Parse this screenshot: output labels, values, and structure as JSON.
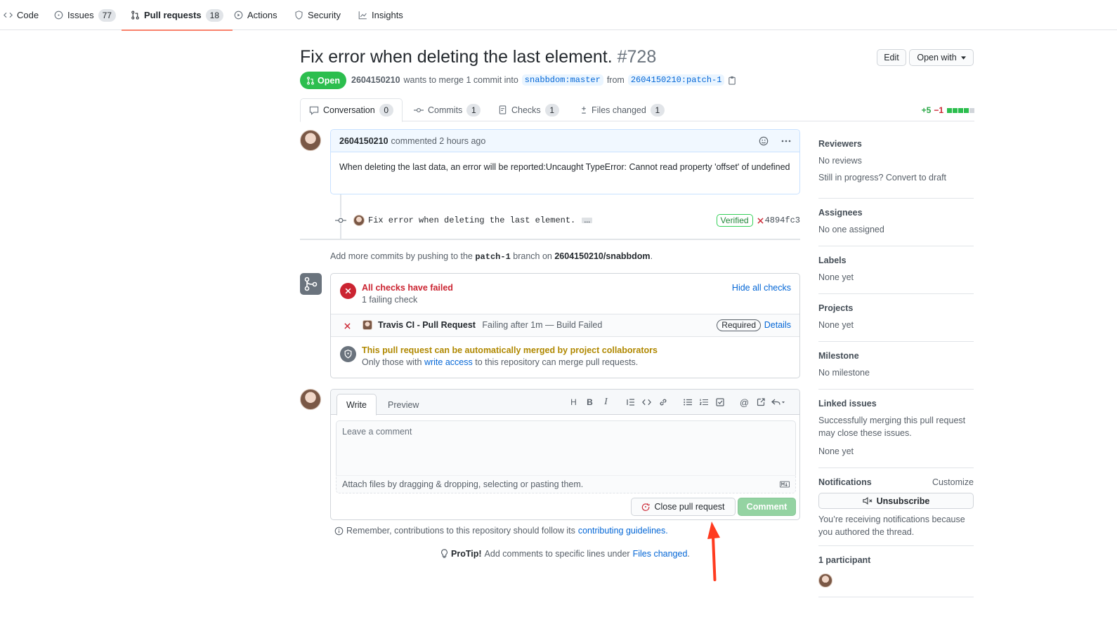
{
  "repo_nav": {
    "items": [
      {
        "label": "Code",
        "count": null
      },
      {
        "label": "Issues",
        "count": "77"
      },
      {
        "label": "Pull requests",
        "count": "18"
      },
      {
        "label": "Actions",
        "count": null
      },
      {
        "label": "Security",
        "count": null
      },
      {
        "label": "Insights",
        "count": null
      }
    ]
  },
  "header": {
    "title": "Fix error when deleting the last element.",
    "number": "#728",
    "edit_label": "Edit",
    "open_with_label": "Open with",
    "state": "Open",
    "author": "2604150210",
    "merge_text": "wants to merge 1 commit into",
    "base_branch": "snabbdom:master",
    "from_text": "from",
    "head_branch": "2604150210:patch-1"
  },
  "tabs": [
    {
      "label": "Conversation",
      "count": "0"
    },
    {
      "label": "Commits",
      "count": "1"
    },
    {
      "label": "Checks",
      "count": "1"
    },
    {
      "label": "Files changed",
      "count": "1"
    }
  ],
  "diffstat": {
    "additions": "+5",
    "deletions": "−1"
  },
  "comment": {
    "author": "2604150210",
    "meta": "commented 2 hours ago",
    "body": "When deleting the last data, an error will be reported:Uncaught TypeError: Cannot read property 'offset' of undefined"
  },
  "commit": {
    "message": "Fix error when deleting the last element.",
    "ellipsis": "…",
    "verified": "Verified",
    "sha": "4894fc3"
  },
  "push_note": {
    "prefix": "Add more commits by pushing to the",
    "branch": "patch-1",
    "middle": "branch on",
    "repo": "2604150210/snabbdom",
    "suffix": "."
  },
  "checks": {
    "title": "All checks have failed",
    "subtitle": "1 failing check",
    "hide_label": "Hide all checks",
    "check_name": "Travis CI - Pull Request",
    "check_status": "Failing after 1m — Build Failed",
    "required": "Required",
    "details": "Details",
    "merge_title": "This pull request can be automatically merged by project collaborators",
    "merge_prefix": "Only those with",
    "merge_link": "write access",
    "merge_suffix": "to this repository can merge pull requests."
  },
  "editor": {
    "write_tab": "Write",
    "preview_tab": "Preview",
    "placeholder": "Leave a comment",
    "attach_text": "Attach files by dragging & dropping, selecting or pasting them.",
    "close_label": "Close pull request",
    "comment_label": "Comment"
  },
  "notes": {
    "contrib_prefix": "Remember, contributions to this repository should follow its",
    "contrib_link": "contributing guidelines",
    "contrib_suffix": ".",
    "protip_bold": "ProTip!",
    "protip_text": "Add comments to specific lines under",
    "protip_link": "Files changed",
    "protip_suffix": "."
  },
  "sidebar": {
    "reviewers_h": "Reviewers",
    "reviewers_t": "No reviews",
    "reviewers_t2": "Still in progress? Convert to draft",
    "assignees_h": "Assignees",
    "assignees_t": "No one assigned",
    "labels_h": "Labels",
    "labels_t": "None yet",
    "projects_h": "Projects",
    "projects_t": "None yet",
    "milestone_h": "Milestone",
    "milestone_t": "No milestone",
    "linked_h": "Linked issues",
    "linked_t": "Successfully merging this pull request may close these issues.",
    "linked_t2": "None yet",
    "notifications_h": "Notifications",
    "customize": "Customize",
    "unsubscribe": "Unsubscribe",
    "notif_reason": "You’re receiving notifications because you authored the thread.",
    "participants_h": "1 participant"
  },
  "colors": {
    "open_green": "#2cbe4e",
    "fail_red": "#cb2431",
    "warn_yellow": "#b08800",
    "link_blue": "#0366d6",
    "annotation_arrow": "#ff3b1f"
  }
}
